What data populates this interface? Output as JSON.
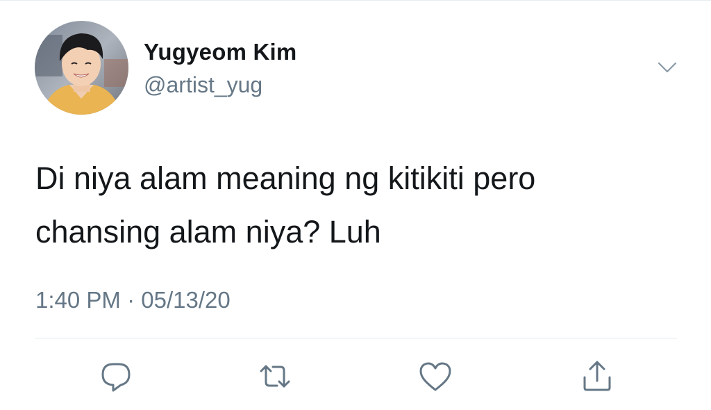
{
  "tweet": {
    "author": {
      "display_name": "Yugyeom Kim",
      "handle": "@artist_yug"
    },
    "text_lines": [
      "Di niya alam meaning ng kitikiti pero",
      "chansing alam niya? Luh"
    ],
    "time": "1:40 PM",
    "separator": "·",
    "date": "05/13/20"
  },
  "icons": {
    "menu": "chevron-down-icon",
    "reply": "reply-icon",
    "retweet": "retweet-icon",
    "like": "heart-icon",
    "share": "share-icon"
  },
  "colors": {
    "text": "#14171a",
    "secondary": "#657786",
    "icon": "#657786",
    "divider": "#e1e8ed"
  }
}
